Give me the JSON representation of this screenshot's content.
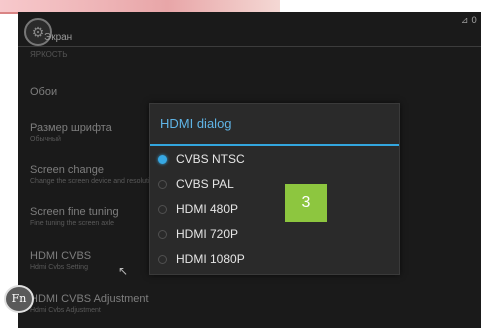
{
  "status": {
    "text": "⊿ 0"
  },
  "header": {
    "title": "Экран",
    "icon": "settings-back-icon",
    "section": "Яркость"
  },
  "settings": [
    {
      "title": "Обои",
      "subtitle": ""
    },
    {
      "title": "Размер шрифта",
      "subtitle": "Обычный"
    },
    {
      "title": "Screen change",
      "subtitle": "Change the screen device and resolution"
    },
    {
      "title": "Screen fine tuning",
      "subtitle": "Fine tuning the screen axle"
    },
    {
      "title": "HDMI CVBS",
      "subtitle": "Hdmi Cvbs Setting"
    },
    {
      "title": "HDMI CVBS Adjustment",
      "subtitle": "Hdmi Cvbs Adjustment"
    }
  ],
  "dialog": {
    "title": "HDMI dialog",
    "options": [
      {
        "label": "CVBS NTSC",
        "selected": true
      },
      {
        "label": "CVBS PAL",
        "selected": false
      },
      {
        "label": "HDMI 480P",
        "selected": false
      },
      {
        "label": "HDMI 720P",
        "selected": false
      },
      {
        "label": "HDMI 1080P",
        "selected": false
      }
    ]
  },
  "badge": {
    "text": "3",
    "color": "#8dc63f"
  },
  "accent": "#33a6de",
  "logo": {
    "text": "Fn"
  }
}
